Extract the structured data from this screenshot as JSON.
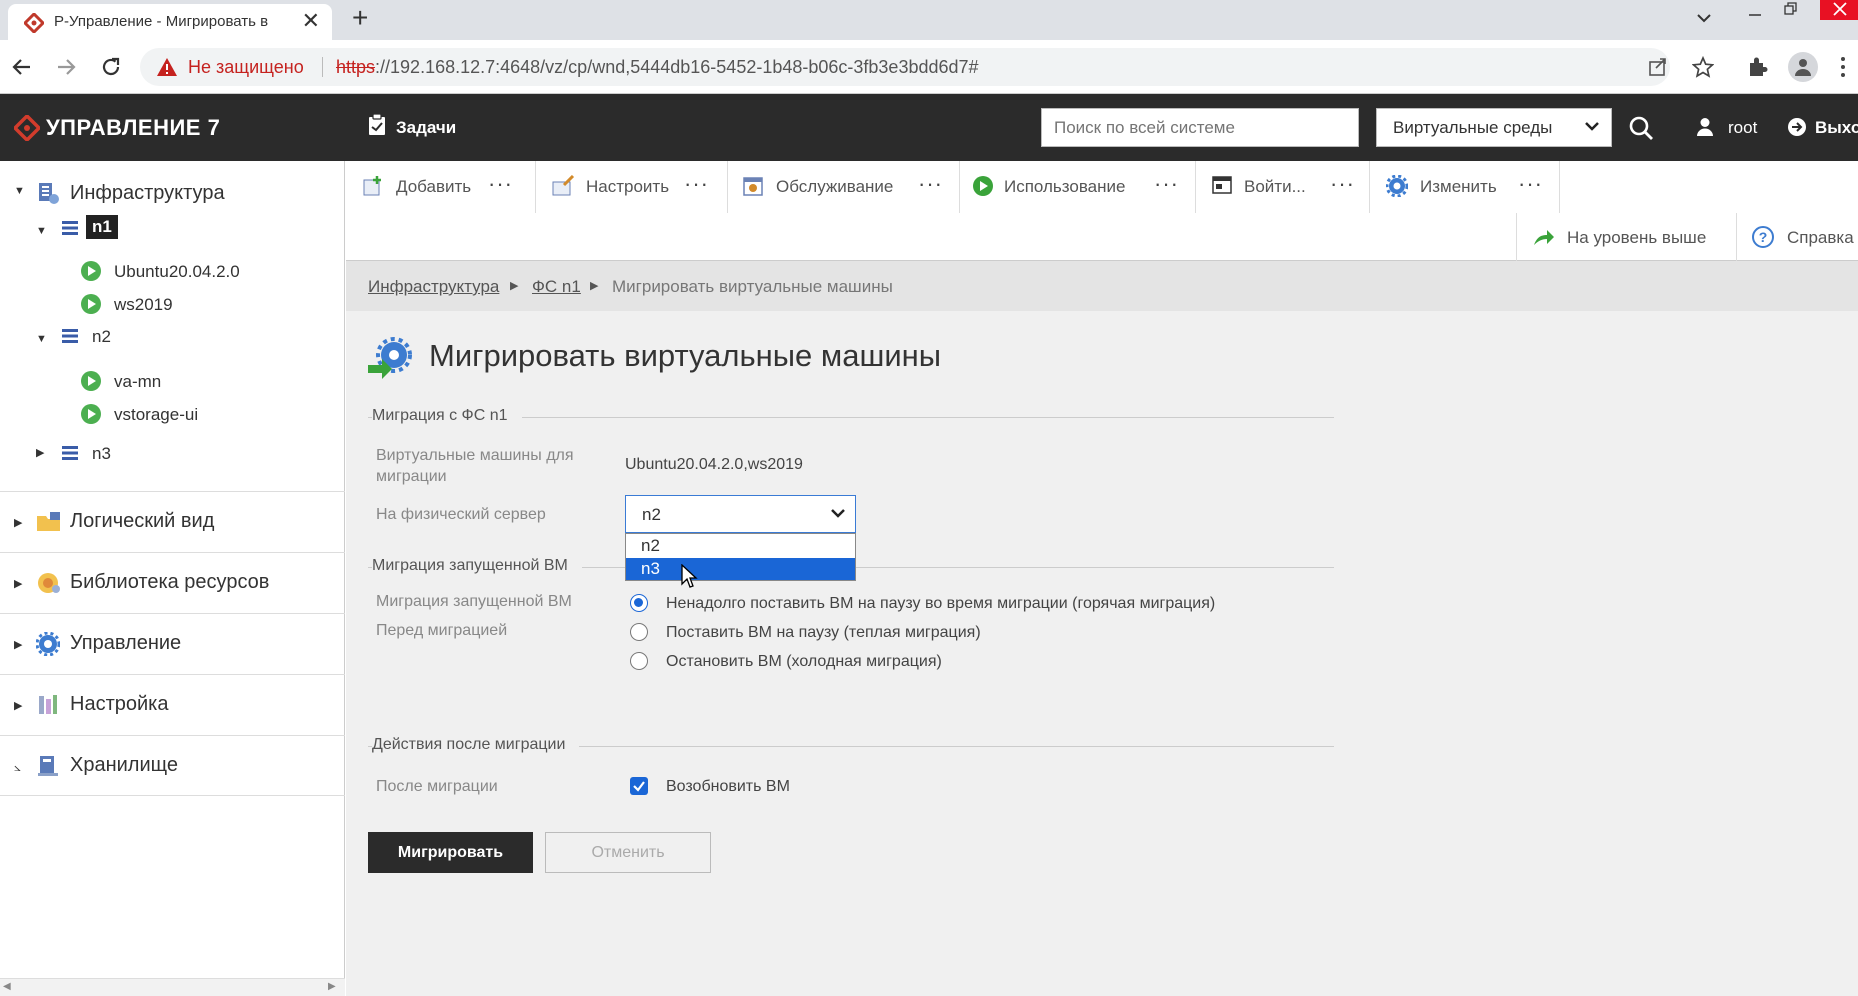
{
  "browser": {
    "tab_title": "Р-Управление - Мигрировать в",
    "insecure_label": "Не защищено",
    "url_scheme": "https",
    "url_rest": "://192.168.12.7:4648/vz/cp/wnd,5444db16-5452-1b48-b06c-3fb3e3bdd6d7#"
  },
  "header": {
    "app_title": "УПРАВЛЕНИЕ 7",
    "tasks_label": "Задачи",
    "search_placeholder": "Поиск по всей системе",
    "env_select_value": "Виртуальные среды",
    "user": "root",
    "exit_label": "Выход"
  },
  "sidebar": {
    "infra_label": "Инфраструктура",
    "nodes": [
      {
        "label": "n1",
        "vms": [
          "Ubuntu20.04.2.0",
          "ws2019"
        ]
      },
      {
        "label": "n2",
        "vms": [
          "va-mn",
          "vstorage-ui"
        ]
      },
      {
        "label": "n3",
        "vms": []
      }
    ],
    "sections": [
      "Логический вид",
      "Библиотека ресурсов",
      "Управление",
      "Настройка",
      "Хранилище"
    ]
  },
  "toolbar": {
    "add": "Добавить",
    "configure": "Настроить",
    "maintenance": "Обслуживание",
    "usage": "Использование",
    "login": "Войти...",
    "change": "Изменить",
    "up_level": "На уровень выше",
    "help": "Справка"
  },
  "breadcrumb": {
    "items": [
      "Инфраструктура",
      "ФС n1"
    ],
    "current": "Мигрировать виртуальные машины"
  },
  "page": {
    "title": "Мигрировать виртуальные машины",
    "section_source": "Миграция с ФС n1",
    "vms_label": "Виртуальные машины для миграции",
    "vms_value": "Ubuntu20.04.2.0,ws2019",
    "server_label": "На физический сервер",
    "server_value": "n2",
    "server_options": [
      "n2",
      "n3"
    ],
    "server_highlighted": "n3",
    "section_running": "Миграция запущенной ВМ",
    "running_label": "Миграция запущенной ВМ",
    "before_label": "Перед миграцией",
    "migration_options": [
      "Ненадолго поставить ВМ на паузу во время миграции (горячая миграция)",
      "Поставить ВМ на паузу (теплая миграция)",
      "Остановить ВМ (холодная миграция)"
    ],
    "migration_selected_index": 0,
    "section_after": "Действия после миграции",
    "after_label": "После миграции",
    "resume_label": "Возобновить ВМ",
    "resume_checked": true,
    "btn_migrate": "Мигрировать",
    "btn_cancel": "Отменить"
  },
  "colors": {
    "accent_blue": "#1a66d6",
    "header_dark": "#2b2b2b",
    "running_green": "#4caf50",
    "insecure_red": "#c5221f"
  }
}
